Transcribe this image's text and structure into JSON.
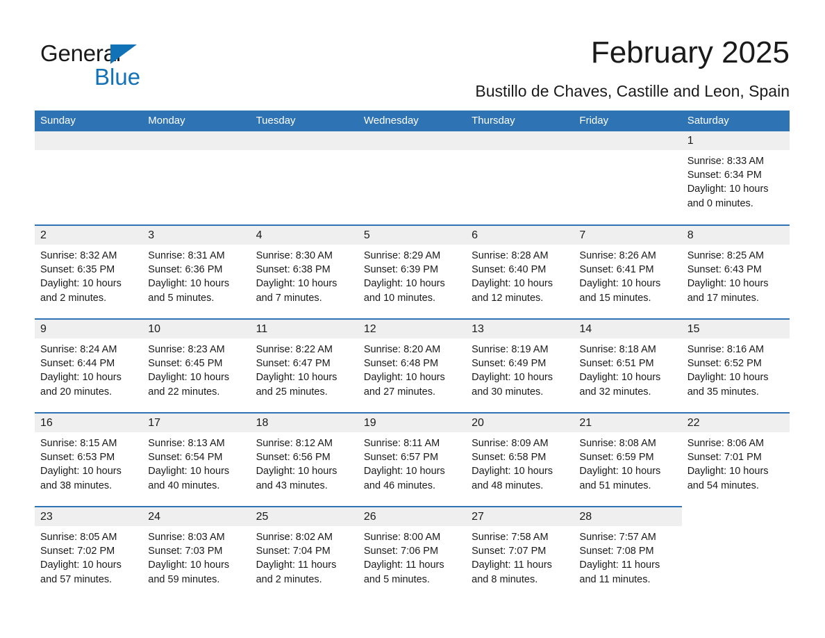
{
  "brand": {
    "name_part1": "General",
    "name_part2": "Blue",
    "accent_color": "#1272b8"
  },
  "header": {
    "title": "February 2025",
    "location": "Bustillo de Chaves, Castille and Leon, Spain",
    "header_bg_color": "#2e74b5",
    "daynum_bg_color": "#efefef"
  },
  "weekdays": [
    "Sunday",
    "Monday",
    "Tuesday",
    "Wednesday",
    "Thursday",
    "Friday",
    "Saturday"
  ],
  "labels": {
    "sunrise_prefix": "Sunrise: ",
    "sunset_prefix": "Sunset: ",
    "daylight_prefix": "Daylight: "
  },
  "weeks": [
    [
      {
        "day": "",
        "sunrise": "",
        "sunset": "",
        "daylight_line1": "",
        "daylight_line2": "",
        "empty": true
      },
      {
        "day": "",
        "sunrise": "",
        "sunset": "",
        "daylight_line1": "",
        "daylight_line2": "",
        "empty": true
      },
      {
        "day": "",
        "sunrise": "",
        "sunset": "",
        "daylight_line1": "",
        "daylight_line2": "",
        "empty": true
      },
      {
        "day": "",
        "sunrise": "",
        "sunset": "",
        "daylight_line1": "",
        "daylight_line2": "",
        "empty": true
      },
      {
        "day": "",
        "sunrise": "",
        "sunset": "",
        "daylight_line1": "",
        "daylight_line2": "",
        "empty": true
      },
      {
        "day": "",
        "sunrise": "",
        "sunset": "",
        "daylight_line1": "",
        "daylight_line2": "",
        "empty": true
      },
      {
        "day": "1",
        "sunrise": "Sunrise: 8:33 AM",
        "sunset": "Sunset: 6:34 PM",
        "daylight_line1": "Daylight: 10 hours",
        "daylight_line2": "and 0 minutes."
      }
    ],
    [
      {
        "day": "2",
        "sunrise": "Sunrise: 8:32 AM",
        "sunset": "Sunset: 6:35 PM",
        "daylight_line1": "Daylight: 10 hours",
        "daylight_line2": "and 2 minutes."
      },
      {
        "day": "3",
        "sunrise": "Sunrise: 8:31 AM",
        "sunset": "Sunset: 6:36 PM",
        "daylight_line1": "Daylight: 10 hours",
        "daylight_line2": "and 5 minutes."
      },
      {
        "day": "4",
        "sunrise": "Sunrise: 8:30 AM",
        "sunset": "Sunset: 6:38 PM",
        "daylight_line1": "Daylight: 10 hours",
        "daylight_line2": "and 7 minutes."
      },
      {
        "day": "5",
        "sunrise": "Sunrise: 8:29 AM",
        "sunset": "Sunset: 6:39 PM",
        "daylight_line1": "Daylight: 10 hours",
        "daylight_line2": "and 10 minutes."
      },
      {
        "day": "6",
        "sunrise": "Sunrise: 8:28 AM",
        "sunset": "Sunset: 6:40 PM",
        "daylight_line1": "Daylight: 10 hours",
        "daylight_line2": "and 12 minutes."
      },
      {
        "day": "7",
        "sunrise": "Sunrise: 8:26 AM",
        "sunset": "Sunset: 6:41 PM",
        "daylight_line1": "Daylight: 10 hours",
        "daylight_line2": "and 15 minutes."
      },
      {
        "day": "8",
        "sunrise": "Sunrise: 8:25 AM",
        "sunset": "Sunset: 6:43 PM",
        "daylight_line1": "Daylight: 10 hours",
        "daylight_line2": "and 17 minutes."
      }
    ],
    [
      {
        "day": "9",
        "sunrise": "Sunrise: 8:24 AM",
        "sunset": "Sunset: 6:44 PM",
        "daylight_line1": "Daylight: 10 hours",
        "daylight_line2": "and 20 minutes."
      },
      {
        "day": "10",
        "sunrise": "Sunrise: 8:23 AM",
        "sunset": "Sunset: 6:45 PM",
        "daylight_line1": "Daylight: 10 hours",
        "daylight_line2": "and 22 minutes."
      },
      {
        "day": "11",
        "sunrise": "Sunrise: 8:22 AM",
        "sunset": "Sunset: 6:47 PM",
        "daylight_line1": "Daylight: 10 hours",
        "daylight_line2": "and 25 minutes."
      },
      {
        "day": "12",
        "sunrise": "Sunrise: 8:20 AM",
        "sunset": "Sunset: 6:48 PM",
        "daylight_line1": "Daylight: 10 hours",
        "daylight_line2": "and 27 minutes."
      },
      {
        "day": "13",
        "sunrise": "Sunrise: 8:19 AM",
        "sunset": "Sunset: 6:49 PM",
        "daylight_line1": "Daylight: 10 hours",
        "daylight_line2": "and 30 minutes."
      },
      {
        "day": "14",
        "sunrise": "Sunrise: 8:18 AM",
        "sunset": "Sunset: 6:51 PM",
        "daylight_line1": "Daylight: 10 hours",
        "daylight_line2": "and 32 minutes."
      },
      {
        "day": "15",
        "sunrise": "Sunrise: 8:16 AM",
        "sunset": "Sunset: 6:52 PM",
        "daylight_line1": "Daylight: 10 hours",
        "daylight_line2": "and 35 minutes."
      }
    ],
    [
      {
        "day": "16",
        "sunrise": "Sunrise: 8:15 AM",
        "sunset": "Sunset: 6:53 PM",
        "daylight_line1": "Daylight: 10 hours",
        "daylight_line2": "and 38 minutes."
      },
      {
        "day": "17",
        "sunrise": "Sunrise: 8:13 AM",
        "sunset": "Sunset: 6:54 PM",
        "daylight_line1": "Daylight: 10 hours",
        "daylight_line2": "and 40 minutes."
      },
      {
        "day": "18",
        "sunrise": "Sunrise: 8:12 AM",
        "sunset": "Sunset: 6:56 PM",
        "daylight_line1": "Daylight: 10 hours",
        "daylight_line2": "and 43 minutes."
      },
      {
        "day": "19",
        "sunrise": "Sunrise: 8:11 AM",
        "sunset": "Sunset: 6:57 PM",
        "daylight_line1": "Daylight: 10 hours",
        "daylight_line2": "and 46 minutes."
      },
      {
        "day": "20",
        "sunrise": "Sunrise: 8:09 AM",
        "sunset": "Sunset: 6:58 PM",
        "daylight_line1": "Daylight: 10 hours",
        "daylight_line2": "and 48 minutes."
      },
      {
        "day": "21",
        "sunrise": "Sunrise: 8:08 AM",
        "sunset": "Sunset: 6:59 PM",
        "daylight_line1": "Daylight: 10 hours",
        "daylight_line2": "and 51 minutes."
      },
      {
        "day": "22",
        "sunrise": "Sunrise: 8:06 AM",
        "sunset": "Sunset: 7:01 PM",
        "daylight_line1": "Daylight: 10 hours",
        "daylight_line2": "and 54 minutes."
      }
    ],
    [
      {
        "day": "23",
        "sunrise": "Sunrise: 8:05 AM",
        "sunset": "Sunset: 7:02 PM",
        "daylight_line1": "Daylight: 10 hours",
        "daylight_line2": "and 57 minutes."
      },
      {
        "day": "24",
        "sunrise": "Sunrise: 8:03 AM",
        "sunset": "Sunset: 7:03 PM",
        "daylight_line1": "Daylight: 10 hours",
        "daylight_line2": "and 59 minutes."
      },
      {
        "day": "25",
        "sunrise": "Sunrise: 8:02 AM",
        "sunset": "Sunset: 7:04 PM",
        "daylight_line1": "Daylight: 11 hours",
        "daylight_line2": "and 2 minutes."
      },
      {
        "day": "26",
        "sunrise": "Sunrise: 8:00 AM",
        "sunset": "Sunset: 7:06 PM",
        "daylight_line1": "Daylight: 11 hours",
        "daylight_line2": "and 5 minutes."
      },
      {
        "day": "27",
        "sunrise": "Sunrise: 7:58 AM",
        "sunset": "Sunset: 7:07 PM",
        "daylight_line1": "Daylight: 11 hours",
        "daylight_line2": "and 8 minutes."
      },
      {
        "day": "28",
        "sunrise": "Sunrise: 7:57 AM",
        "sunset": "Sunset: 7:08 PM",
        "daylight_line1": "Daylight: 11 hours",
        "daylight_line2": "and 11 minutes."
      },
      {
        "day": "",
        "sunrise": "",
        "sunset": "",
        "daylight_line1": "",
        "daylight_line2": "",
        "trailing": true
      }
    ]
  ]
}
